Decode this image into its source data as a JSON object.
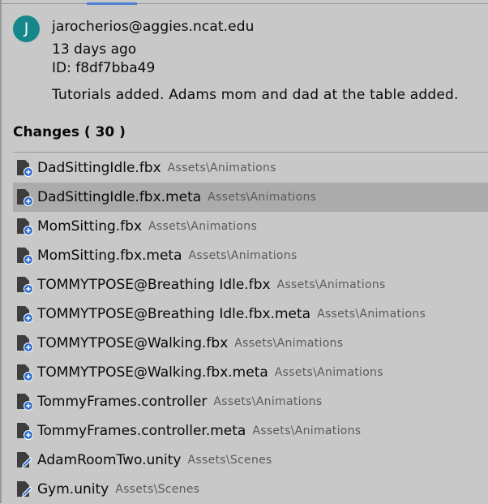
{
  "commit": {
    "avatar_letter": "J",
    "author": "jarocherios@aggies.ncat.edu",
    "age": "13 days ago",
    "id": "ID: f8df7bba49",
    "message": "Tutorials added. Adams mom and dad at the table added."
  },
  "changes": {
    "title": "Changes ( 30 )",
    "items": [
      {
        "name": "DadSittingIdle.fbx",
        "path": "Assets\\Animations",
        "icon": "file-added-icon"
      },
      {
        "name": "DadSittingIdle.fbx.meta",
        "path": "Assets\\Animations",
        "icon": "file-added-icon"
      },
      {
        "name": "MomSitting.fbx",
        "path": "Assets\\Animations",
        "icon": "file-added-icon"
      },
      {
        "name": "MomSitting.fbx.meta",
        "path": "Assets\\Animations",
        "icon": "file-added-icon"
      },
      {
        "name": "TOMMYTPOSE@Breathing Idle.fbx",
        "path": "Assets\\Animations",
        "icon": "file-added-icon"
      },
      {
        "name": "TOMMYTPOSE@Breathing Idle.fbx.meta",
        "path": "Assets\\Animations",
        "icon": "file-added-icon"
      },
      {
        "name": "TOMMYTPOSE@Walking.fbx",
        "path": "Assets\\Animations",
        "icon": "file-added-icon"
      },
      {
        "name": "TOMMYTPOSE@Walking.fbx.meta",
        "path": "Assets\\Animations",
        "icon": "file-added-icon"
      },
      {
        "name": "TommyFrames.controller",
        "path": "Assets\\Animations",
        "icon": "file-added-icon"
      },
      {
        "name": "TommyFrames.controller.meta",
        "path": "Assets\\Animations",
        "icon": "file-added-icon"
      },
      {
        "name": "AdamRoomTwo.unity",
        "path": "Assets\\Scenes",
        "icon": "file-modified-icon"
      },
      {
        "name": "Gym.unity",
        "path": "Assets\\Scenes",
        "icon": "file-modified-icon"
      }
    ],
    "selected_index": 1
  },
  "colors": {
    "panel_bg": "#c8c8c8",
    "selected_row": "#ababab",
    "accent": "#4c7fd0",
    "avatar": "#16878a",
    "path_text": "#5a5a5a"
  }
}
